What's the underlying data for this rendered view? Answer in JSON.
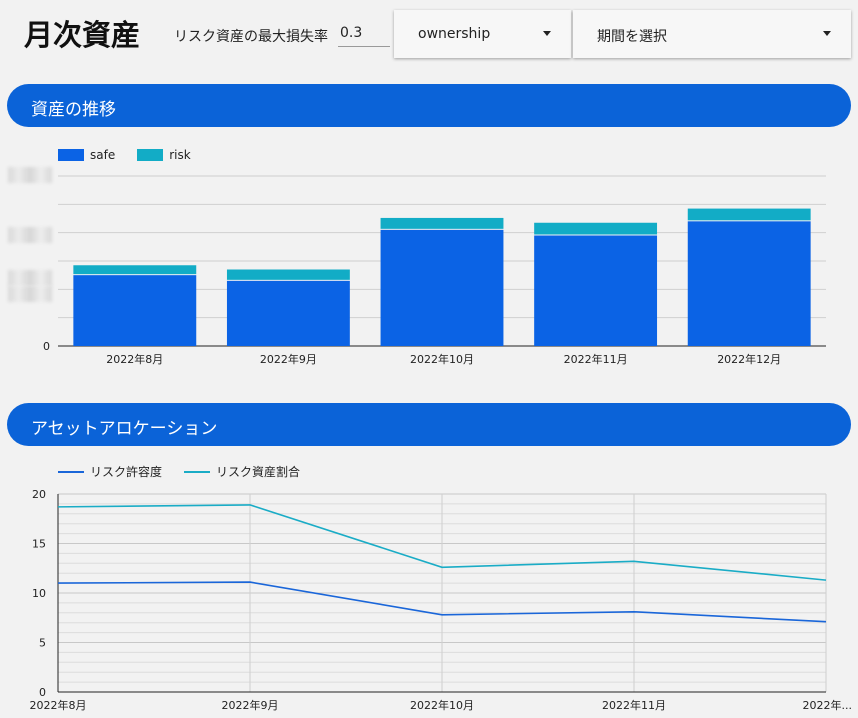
{
  "header": {
    "title": "月次資産",
    "risk_label": "リスク資産の最大損失率",
    "risk_value": "0.3",
    "ownership_dropdown": "ownership",
    "period_dropdown": "期間を選択"
  },
  "sections": {
    "asset_trend": "資産の推移",
    "allocation": "アセットアロケーション"
  },
  "colors": {
    "accent": "#0b63d8",
    "safe": "#0b63e5",
    "risk": "#12acc6",
    "tolerance": "#1a66d9",
    "risk_ratio": "#1aacc6"
  },
  "chart_data": [
    {
      "type": "bar",
      "stacked": true,
      "categories": [
        "2022年8月",
        "2022年9月",
        "2022年10月",
        "2022年11月",
        "2022年12月"
      ],
      "series": [
        {
          "name": "safe",
          "values": [
            25,
            23,
            41,
            39,
            44
          ]
        },
        {
          "name": "risk",
          "values": [
            3.5,
            4,
            4.2,
            4.5,
            4.5
          ]
        }
      ],
      "ylim": [
        0,
        60
      ],
      "y_tick_labels": [
        "0"
      ],
      "grid": true,
      "legend": "top-left"
    },
    {
      "type": "line",
      "x": [
        "2022年8月",
        "2022年9月",
        "2022年10月",
        "2022年11月",
        "2022年..."
      ],
      "series": [
        {
          "name": "リスク許容度",
          "values": [
            11.0,
            11.1,
            7.8,
            8.1,
            7.1
          ]
        },
        {
          "name": "リスク資産割合",
          "values": [
            18.7,
            18.9,
            12.6,
            13.2,
            11.3
          ]
        }
      ],
      "ylim": [
        0,
        20
      ],
      "y_ticks": [
        0,
        5,
        10,
        15,
        20
      ],
      "grid": true,
      "legend": "top-left"
    }
  ]
}
